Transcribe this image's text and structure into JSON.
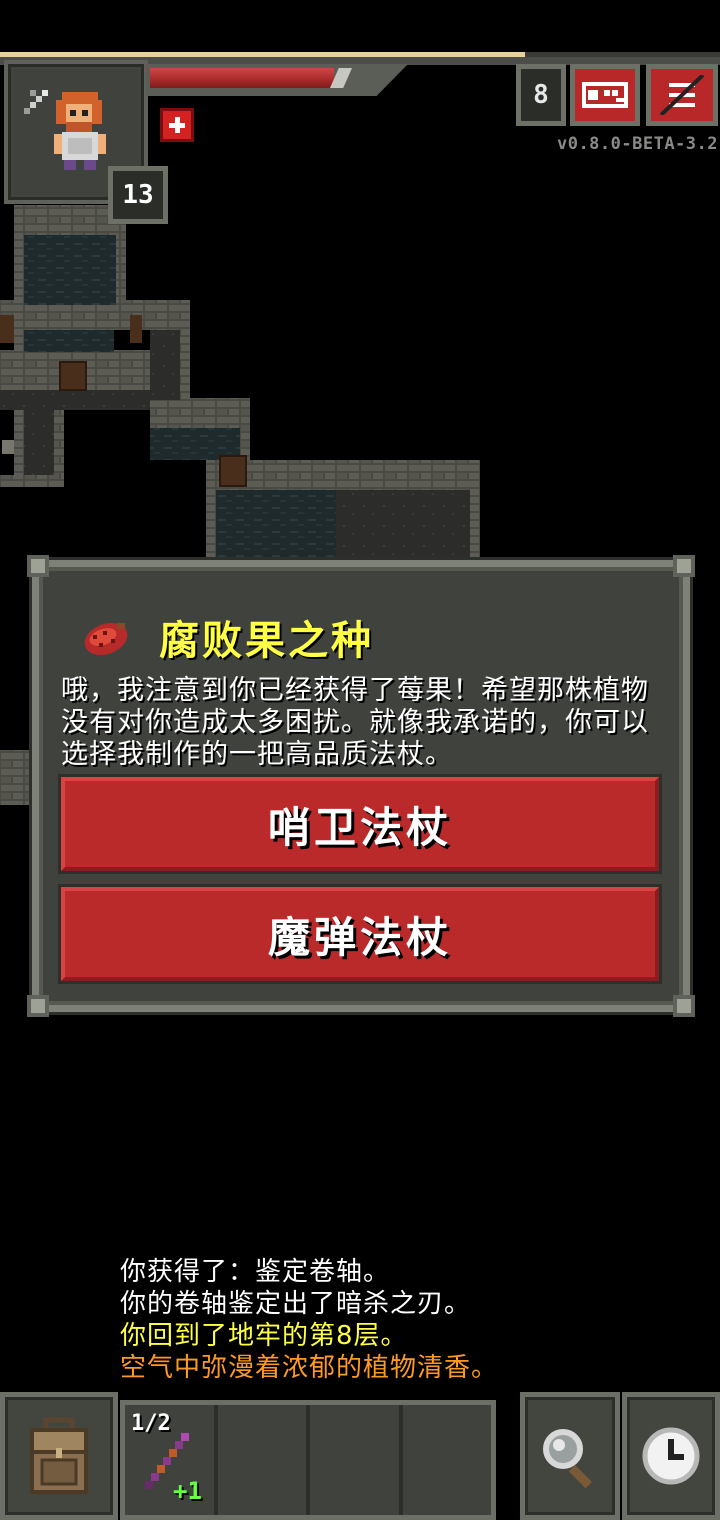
{
  "hud": {
    "hero_level": "13",
    "depth": "8",
    "version": "v0.8.0-BETA-3.2",
    "hp_fraction": 0.72,
    "xp_fraction": 0.73
  },
  "dialog": {
    "title": "腐败果之种",
    "body": "哦，我注意到你已经获得了莓果！希望那株植物没有对你造成太多困扰。就像我承诺的，你可以选择我制作的一把高品质法杖。",
    "choices": [
      {
        "label": "哨卫法杖"
      },
      {
        "label": "魔弹法杖"
      }
    ]
  },
  "log": [
    {
      "text": "你获得了：鉴定卷轴。",
      "color": "#ffffff"
    },
    {
      "text": "你的卷轴鉴定出了暗杀之刃。",
      "color": "#ffffff"
    },
    {
      "text": "你回到了地牢的第8层。",
      "color": "#ffff44"
    },
    {
      "text": "空气中弥漫着浓郁的植物清香。",
      "color": "#ff9922"
    }
  ],
  "toolbar": {
    "quickslot_1": {
      "count": "1/2",
      "upgrade": "+1",
      "icon": "wand-icon"
    }
  },
  "colors": {
    "accent_red": "#bb2a2a",
    "title_yellow": "#ffff44",
    "panel": "#40433d"
  }
}
